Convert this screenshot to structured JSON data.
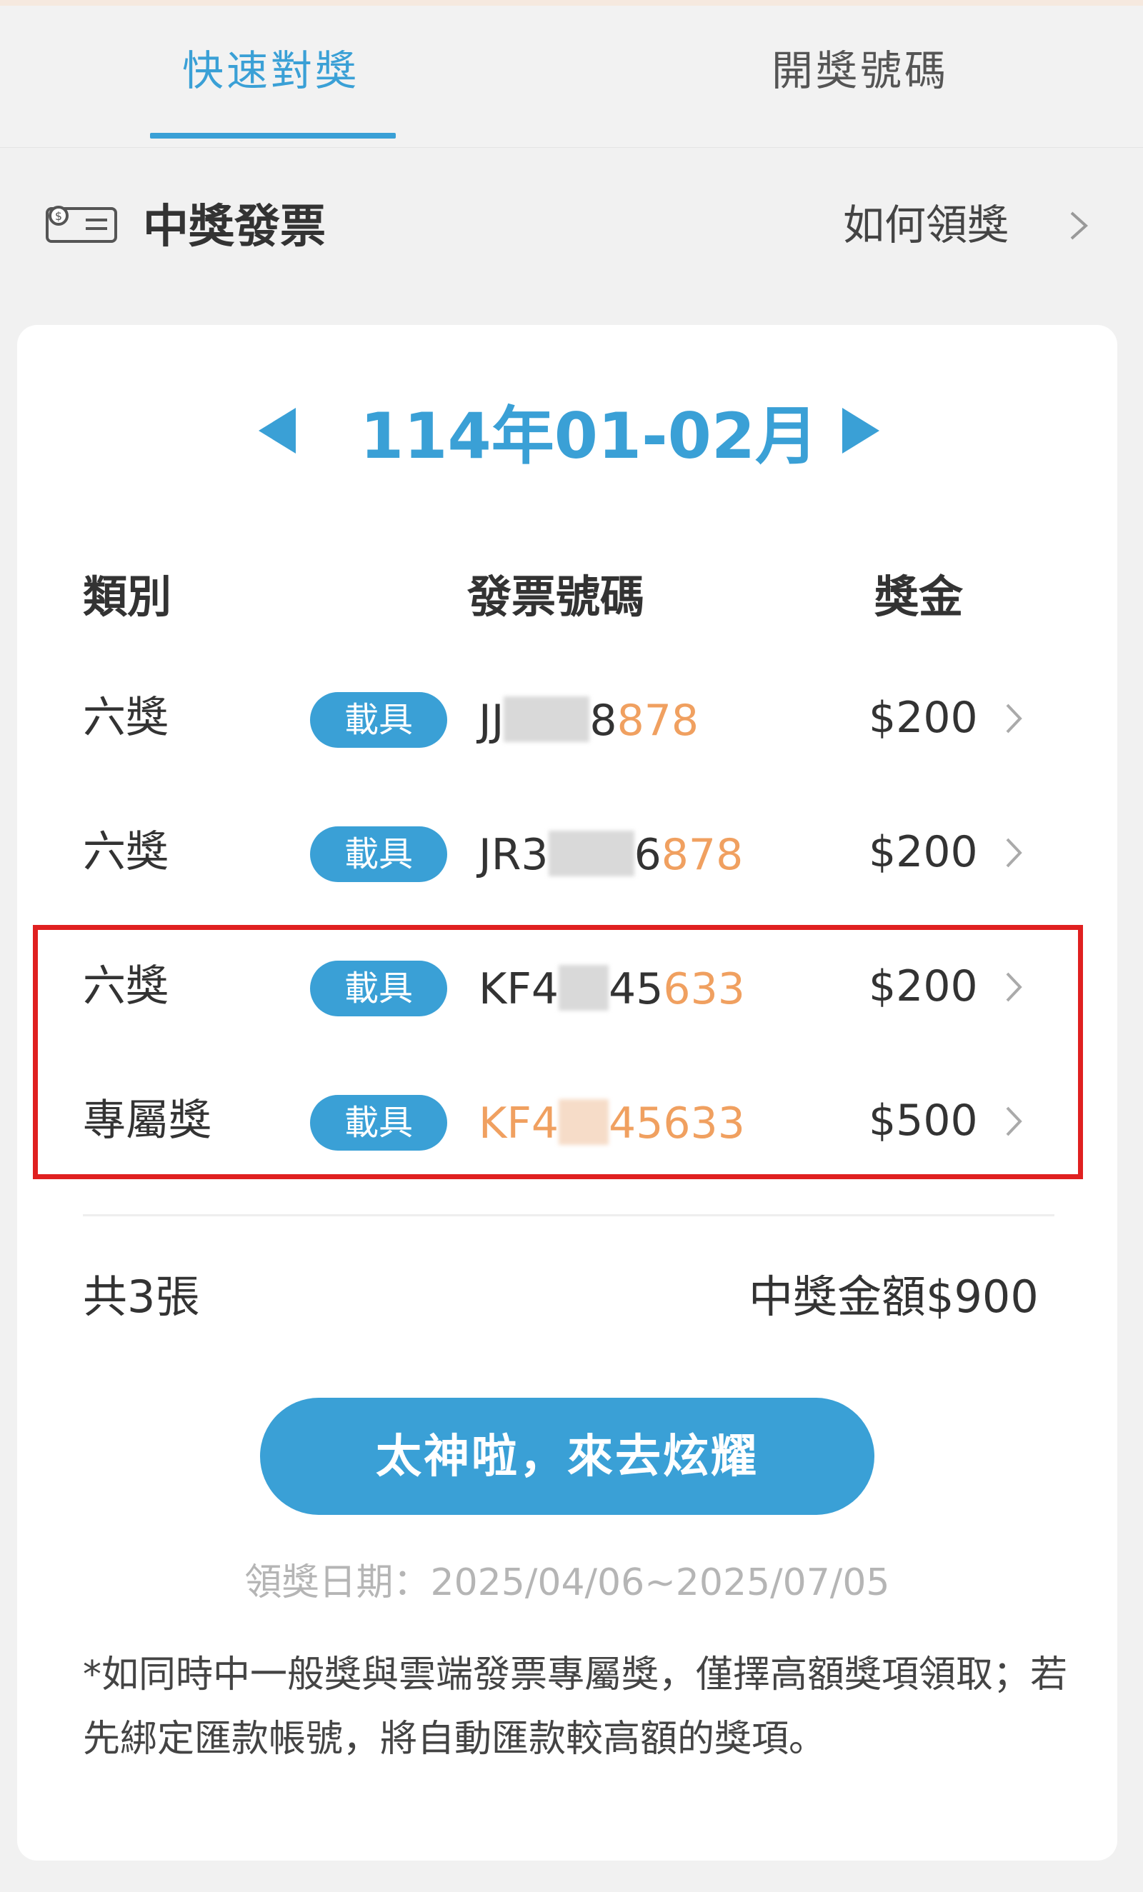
{
  "tabs": [
    {
      "label": "快速對獎",
      "active": true
    },
    {
      "label": "開獎號碼",
      "active": false
    }
  ],
  "header": {
    "icon": "ticket-icon",
    "title": "中獎發票",
    "how_to_label": "如何領獎"
  },
  "period": {
    "label": "114年01-02月"
  },
  "table": {
    "columns": [
      "類別",
      "發票號碼",
      "獎金"
    ],
    "rows": [
      {
        "category": "六獎",
        "badge": "載具",
        "invoice_prefix": "JJ",
        "invoice_mid": "8",
        "invoice_highlight": "878",
        "amount": "$200"
      },
      {
        "category": "六獎",
        "badge": "載具",
        "invoice_prefix": "JR3",
        "invoice_mid": "6",
        "invoice_highlight": "878",
        "amount": "$200"
      },
      {
        "category": "六獎",
        "badge": "載具",
        "invoice_prefix": "KF4",
        "invoice_mid": "45",
        "invoice_highlight": "633",
        "amount": "$200"
      },
      {
        "category": "專屬獎",
        "badge": "載具",
        "invoice_prefix": "KF4",
        "invoice_mid": "",
        "invoice_highlight": "45633",
        "amount": "$500"
      }
    ]
  },
  "summary": {
    "count": "共3張",
    "total": "中獎金額$900"
  },
  "share_button": "太神啦，來去炫耀",
  "claim_date": "領獎日期：2025/04/06~2025/07/05",
  "note": "*如同時中一般獎與雲端發票專屬獎，僅擇高額獎項領取；若先綁定匯款帳號，將自動匯款較高額的獎項。",
  "colors": {
    "accent": "#3aa0d6",
    "highlight": "#f0a060",
    "alert_box": "#e02020"
  }
}
